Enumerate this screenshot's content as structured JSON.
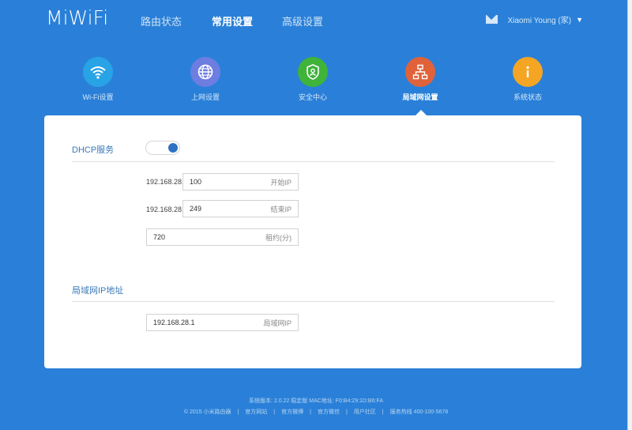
{
  "header": {
    "logo": "MiWiFi",
    "nav": [
      "路由状态",
      "常用设置",
      "高级设置"
    ],
    "active_nav": "常用设置",
    "user": "Xiaomi Young (家)"
  },
  "iconnav": [
    {
      "label": "Wi-Fi设置",
      "icon": "wifi-icon",
      "color": "#27a3e6"
    },
    {
      "label": "上网设置",
      "icon": "globe-icon",
      "color": "#6d7de0"
    },
    {
      "label": "安全中心",
      "icon": "shield-icon",
      "color": "#3fb33a"
    },
    {
      "label": "局域网设置",
      "icon": "network-icon",
      "color": "#e0623a"
    },
    {
      "label": "系统状态",
      "icon": "info-icon",
      "color": "#f5a524"
    }
  ],
  "active_iconnav": "局域网设置",
  "dhcp": {
    "title": "DHCP服务",
    "enabled": true,
    "prefix": "192.168.28.",
    "start_value": "100",
    "start_hint": "开始IP",
    "end_value": "249",
    "end_hint": "结束IP",
    "lease_value": "720",
    "lease_hint": "租约(分)"
  },
  "lan": {
    "title": "局域网IP地址",
    "ip_value": "192.168.28.1",
    "ip_hint": "局域网IP"
  },
  "footer": {
    "line1": "系统版本: 2.0.22 稳定版   MAC地址: F0:B4:29:1D:B6:FA",
    "links": [
      "© 2015 小米路由器",
      "官方网站",
      "官方微博",
      "官方微信",
      "用户社区",
      "服务热线 400-100-5678"
    ]
  },
  "colors": {
    "background": "#2a80d8",
    "panel": "#ffffff",
    "accent": "#2f72c4"
  }
}
